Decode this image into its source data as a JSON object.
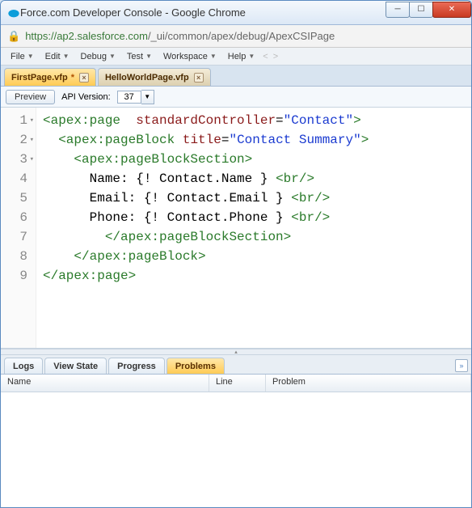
{
  "window": {
    "title": "Force.com Developer Console - Google Chrome"
  },
  "address": {
    "host": "https://ap2.salesforce.com",
    "path": "/_ui/common/apex/debug/ApexCSIPage"
  },
  "menu": {
    "file": "File",
    "edit": "Edit",
    "debug": "Debug",
    "test": "Test",
    "workspace": "Workspace",
    "help": "Help",
    "prev": "<",
    "next": ">"
  },
  "tabs": [
    {
      "label": "FirstPage.vfp",
      "dirty": "*",
      "active": true
    },
    {
      "label": "HelloWorldPage.vfp",
      "dirty": "",
      "active": false
    }
  ],
  "toolbar": {
    "preview": "Preview",
    "api_label": "API Version:",
    "api_value": "37"
  },
  "code": {
    "lines": [
      {
        "n": "1",
        "fold": true,
        "html": "<span class='t-tag'>&lt;apex:page</span>  <span class='t-attr'>standardController</span>=<span class='t-str'>\"Contact\"</span><span class='t-tag'>&gt;</span>"
      },
      {
        "n": "2",
        "fold": true,
        "html": "  <span class='t-tag'>&lt;apex:pageBlock</span> <span class='t-attr'>title</span>=<span class='t-str'>\"Contact Summary\"</span><span class='t-tag'>&gt;</span>"
      },
      {
        "n": "3",
        "fold": true,
        "html": "    <span class='t-tag'>&lt;apex:pageBlockSection&gt;</span>"
      },
      {
        "n": "4",
        "fold": false,
        "html": "      <span class='t-txt'>Name: {! Contact.Name }</span> <span class='t-tag'>&lt;br/&gt;</span>"
      },
      {
        "n": "5",
        "fold": false,
        "html": "      <span class='t-txt'>Email: {! Contact.Email }</span> <span class='t-tag'>&lt;br/&gt;</span>"
      },
      {
        "n": "6",
        "fold": false,
        "html": "      <span class='t-txt'>Phone: {! Contact.Phone }</span> <span class='t-tag'>&lt;br/&gt;</span>"
      },
      {
        "n": "7",
        "fold": false,
        "html": "        <span class='t-tag'>&lt;/apex:pageBlockSection&gt;</span>"
      },
      {
        "n": "8",
        "fold": false,
        "html": "    <span class='t-tag'>&lt;/apex:pageBlock&gt;</span>"
      },
      {
        "n": "9",
        "fold": false,
        "html": "<span class='t-tag'>&lt;/apex:page&gt;</span>"
      }
    ]
  },
  "bottom_tabs": {
    "logs": "Logs",
    "viewstate": "View State",
    "progress": "Progress",
    "problems": "Problems"
  },
  "columns": {
    "name": "Name",
    "line": "Line",
    "problem": "Problem"
  }
}
